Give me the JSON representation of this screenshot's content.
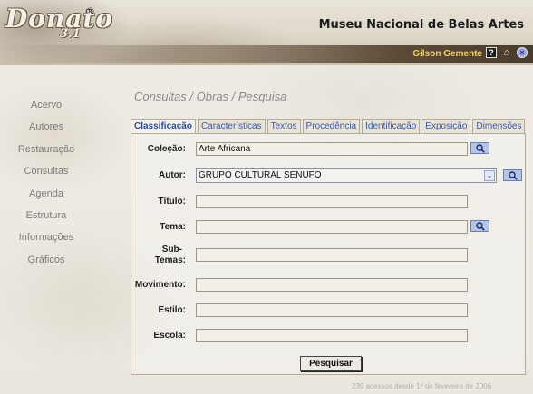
{
  "app": {
    "logo": "Donato",
    "logo_mark": "®",
    "version": "3.1",
    "museum_name": "Museu Nacional de Belas Artes",
    "user_name": "Gilson Gemente",
    "icons": [
      "help-icon",
      "home-icon",
      "exit-icon"
    ]
  },
  "nav": {
    "items": [
      "Acervo",
      "Autores",
      "Restauração",
      "Consultas",
      "Agenda",
      "Estrutura",
      "Informações",
      "Gráficos"
    ]
  },
  "breadcrumb": "Consultas / Obras / Pesquisa",
  "tabs": [
    {
      "label": "Classificação",
      "active": true
    },
    {
      "label": "Características",
      "active": false
    },
    {
      "label": "Textos",
      "active": false
    },
    {
      "label": "Procedência",
      "active": false
    },
    {
      "label": "Identificação",
      "active": false
    },
    {
      "label": "Exposição",
      "active": false
    },
    {
      "label": "Dimensões",
      "active": false
    }
  ],
  "form": {
    "colecao": {
      "label": "Coleção:",
      "value": "Arte Africana"
    },
    "autor": {
      "label": "Autor:",
      "value": "GRUPO CULTURAL SENUFO"
    },
    "titulo": {
      "label": "Título:",
      "value": ""
    },
    "tema": {
      "label": "Tema:",
      "value": ""
    },
    "subtemas": {
      "label_line1": "Sub-",
      "label_line2": "Temas:",
      "value": ""
    },
    "movimento": {
      "label": "Movimento:",
      "value": ""
    },
    "estilo": {
      "label": "Estilo:",
      "value": ""
    },
    "escola": {
      "label": "Escola:",
      "value": ""
    },
    "submit_label": "Pesquisar"
  },
  "footer": "239 acessos desde 1º de fevereiro de 2006",
  "colors": {
    "tab_text": "#3c58a8",
    "user_name": "#f3d25a",
    "search_button": "#b4c4e6"
  }
}
